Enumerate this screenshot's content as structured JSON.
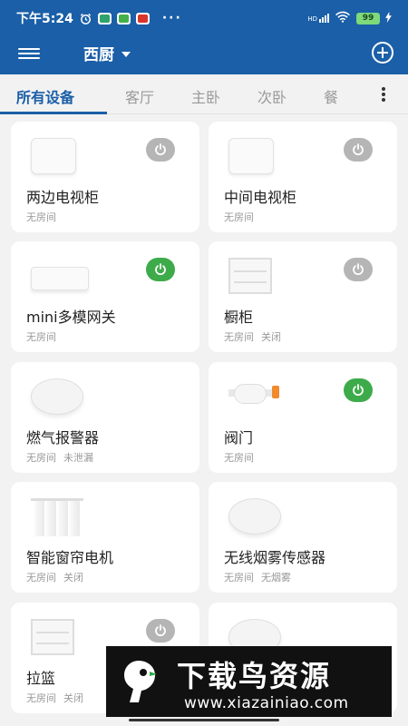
{
  "status_bar": {
    "time": "下午5:24",
    "signal": "HD",
    "battery": "99"
  },
  "header": {
    "room": "西厨"
  },
  "tabs": [
    {
      "label": "所有设备",
      "active": true
    },
    {
      "label": "客厅"
    },
    {
      "label": "主卧"
    },
    {
      "label": "次卧"
    },
    {
      "label": "餐"
    }
  ],
  "devices": [
    {
      "name": "两边电视柜",
      "room": "无房间",
      "state": "",
      "power": "off",
      "icon": "box-icon"
    },
    {
      "name": "中间电视柜",
      "room": "无房间",
      "state": "",
      "power": "off",
      "icon": "box-icon"
    },
    {
      "name": "mini多模网关",
      "room": "无房间",
      "state": "",
      "power": "on",
      "icon": "gateway-icon"
    },
    {
      "name": "橱柜",
      "room": "无房间",
      "state": "关闭",
      "power": "off",
      "icon": "cabinet-icon"
    },
    {
      "name": "燃气报警器",
      "room": "无房间",
      "state": "未泄漏",
      "power": "",
      "icon": "gas-alarm-icon"
    },
    {
      "name": "阀门",
      "room": "无房间",
      "state": "",
      "power": "on",
      "icon": "valve-icon"
    },
    {
      "name": "智能窗帘电机",
      "room": "无房间",
      "state": "关闭",
      "power": "",
      "icon": "curtain-icon"
    },
    {
      "name": "无线烟雾传感器",
      "room": "无房间",
      "state": "无烟雾",
      "power": "",
      "icon": "smoke-sensor-icon"
    },
    {
      "name": "拉篮",
      "room": "无房间",
      "state": "关闭",
      "power": "off",
      "icon": "cabinet-icon"
    },
    {
      "name": "",
      "room": "",
      "state": "",
      "power": "",
      "icon": "round-device-icon"
    }
  ],
  "watermark": {
    "title": "下载鸟资源",
    "url": "www.xiazainiao.com"
  },
  "colors": {
    "primary": "#1a5fa8",
    "power_on": "#3dab4a",
    "power_off": "#b5b5b5"
  }
}
